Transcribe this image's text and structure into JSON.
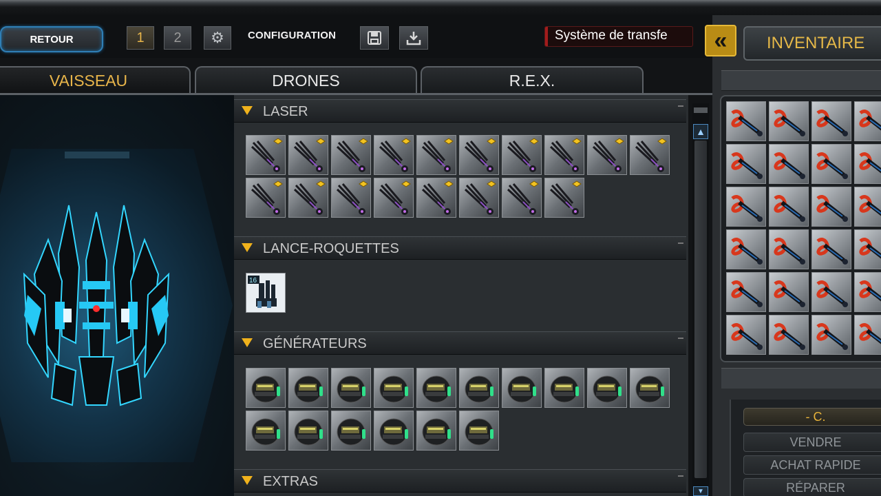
{
  "toolbar": {
    "back_label": "RETOUR",
    "config_slot_1": "1",
    "config_slot_2": "2",
    "config_label": "CONFIGURATION",
    "transfer_label": "Système de transfe"
  },
  "tabs": [
    {
      "label": "VAISSEAU",
      "active": true
    },
    {
      "label": "DRONES",
      "active": false
    },
    {
      "label": "R.E.X.",
      "active": false
    }
  ],
  "categories": [
    {
      "name": "LASER",
      "item_icon": "laser-cannon-icon",
      "count": 18
    },
    {
      "name": "LANCE-ROQUETTES",
      "item_icon": "rocket-launcher-icon",
      "count": 1,
      "badge": "16"
    },
    {
      "name": "GÉNÉRATEURS",
      "item_icon": "generator-icon",
      "count": 16
    },
    {
      "name": "EXTRAS",
      "item_icon": "extra-icon",
      "count": 0
    }
  ],
  "inventory": {
    "title": "INVENTAIRE",
    "collapse_icon": "double-chevron-left-icon",
    "item_icon": "red-laser-icon",
    "visible_items": 24,
    "credits": "- C.",
    "sell_label": "VENDRE",
    "quick_buy_label": "ACHAT RAPIDE",
    "repair_label": "RÉPARER"
  },
  "colors": {
    "accent_gold": "#e8b54a",
    "accent_blue": "#2f7fb6",
    "transfer_red": "#a21c1c",
    "category_triangle": "#f0b21c"
  }
}
